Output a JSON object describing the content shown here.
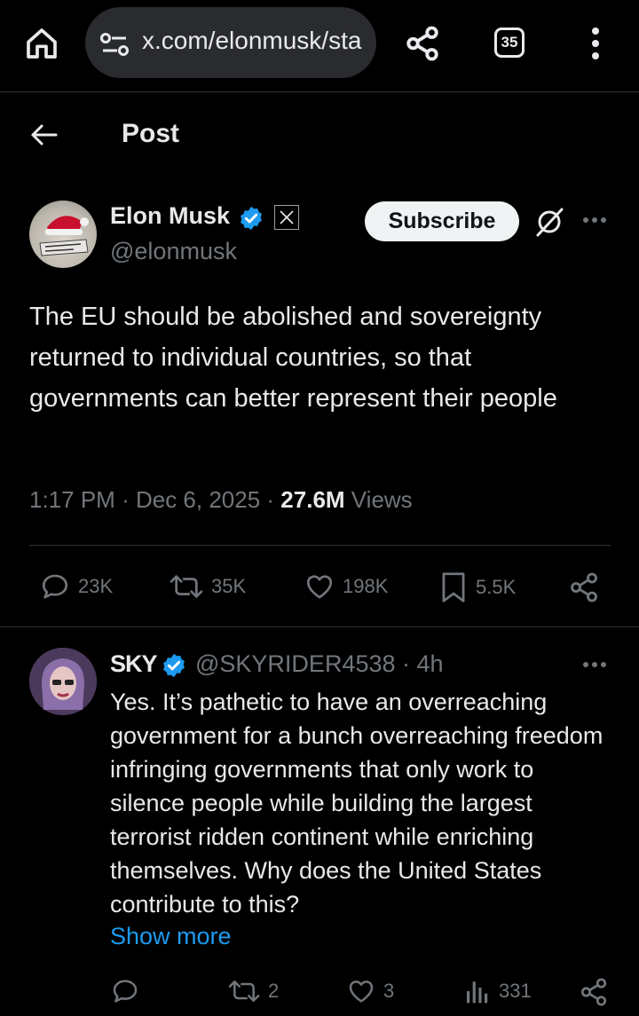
{
  "browser": {
    "url": "x.com/elonmusk/sta",
    "tab_count": "35"
  },
  "header": {
    "title": "Post"
  },
  "post": {
    "author_name": "Elon Musk",
    "author_handle": "@elonmusk",
    "subscribe_label": "Subscribe",
    "text": "The EU should be abolished and sovereignty returned to individual countries, so that governments can better represent their people",
    "time": "1:17 PM",
    "date": "Dec 6, 2025",
    "views_count": "27.6M",
    "views_label": "Views",
    "replies": "23K",
    "reposts": "35K",
    "likes": "198K",
    "bookmarks": "5.5K"
  },
  "reply": {
    "author_name": "SKY",
    "author_handle": "@SKYRIDER4538",
    "age": "4h",
    "text": "Yes. It’s pathetic to have an overreaching government for a bunch overreaching freedom infringing governments that only work to silence people while building the largest terrorist ridden continent while enriching themselves. Why does the United States contribute to this?",
    "show_more_label": "Show more",
    "reposts": "2",
    "likes": "3",
    "views": "331"
  },
  "colors": {
    "background": "#000000",
    "text": "#e7e9ea",
    "muted": "#71767b",
    "accent": "#1d9bf0",
    "divider": "#2f3336"
  },
  "icons": [
    "home-icon",
    "site-settings-icon",
    "share-icon",
    "tab-switcher-icon",
    "more-vert-icon",
    "back-arrow-icon",
    "verified-badge-icon",
    "x-affiliate-icon",
    "grok-icon",
    "more-horiz-icon",
    "reply-icon",
    "repost-icon",
    "like-icon",
    "bookmark-icon",
    "share-post-icon",
    "views-icon"
  ]
}
